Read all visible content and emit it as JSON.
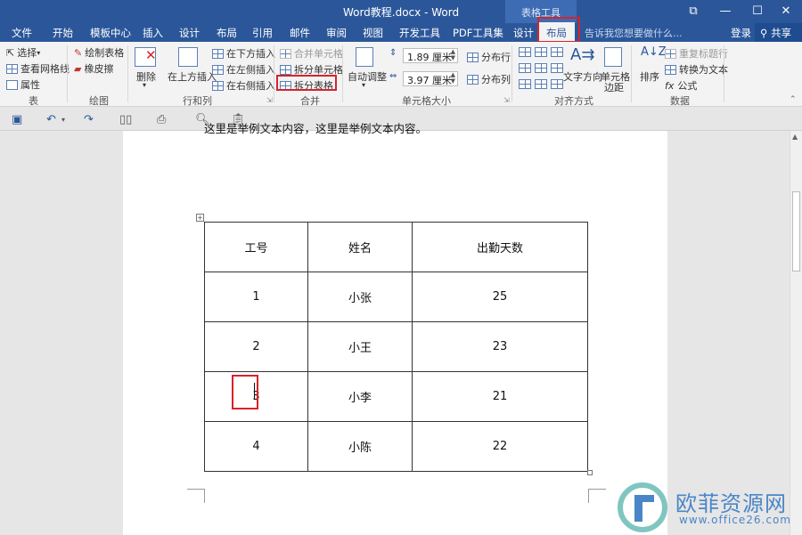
{
  "window": {
    "title": "Word教程.docx - Word",
    "contextual_group": "表格工具",
    "controls": [
      "⧉",
      "—",
      "☐",
      "✕"
    ]
  },
  "tabs": [
    "文件",
    "开始",
    "模板中心",
    "插入",
    "设计",
    "布局",
    "引用",
    "邮件",
    "审阅",
    "视图",
    "开发工具",
    "PDF工具集",
    "设计",
    "布局"
  ],
  "active_tab_index": 13,
  "tell_me": "告诉我您想要做什么...",
  "login": "登录",
  "share": "共享",
  "ribbon": {
    "table_group": {
      "label": "表",
      "select": "选择",
      "view_gridlines": "查看网格线",
      "properties": "属性"
    },
    "draw_group": {
      "label": "绘图",
      "draw_table": "绘制表格",
      "eraser": "橡皮擦"
    },
    "rows_cols_group": {
      "label": "行和列",
      "delete": "删除",
      "insert_above": "在上方插入",
      "insert_below": "在下方插入",
      "insert_left": "在左侧插入",
      "insert_right": "在右侧插入"
    },
    "merge_group": {
      "label": "合并",
      "merge_cells": "合并单元格",
      "split_cells": "拆分单元格",
      "split_table": "拆分表格"
    },
    "cell_size_group": {
      "label": "单元格大小",
      "autofit": "自动调整",
      "height": "1.89 厘米",
      "width": "3.97 厘米",
      "distribute_rows": "分布行",
      "distribute_cols": "分布列"
    },
    "alignment_group": {
      "label": "对齐方式",
      "text_direction": "文字方向",
      "cell_margins_1": "单元格",
      "cell_margins_2": "边距"
    },
    "data_group": {
      "label": "数据",
      "sort": "排序",
      "repeat_header": "重复标题行",
      "convert_text": "转换为文本",
      "formula": "公式",
      "fx": "fx"
    }
  },
  "document": {
    "body_text": "这里是举例文本内容，这里是举例文本内容。",
    "table": {
      "headers": [
        "工号",
        "姓名",
        "出勤天数"
      ],
      "rows": [
        [
          "1",
          "小张",
          "25"
        ],
        [
          "2",
          "小王",
          "23"
        ],
        [
          "3",
          "小李",
          "21"
        ],
        [
          "4",
          "小陈",
          "22"
        ]
      ]
    }
  },
  "watermark": {
    "text": "欧菲资源网",
    "url": "www.office26.com"
  },
  "colors": {
    "word_blue": "#2b579a",
    "highlight_red": "#d6232b",
    "watermark": "#4a86c7"
  }
}
